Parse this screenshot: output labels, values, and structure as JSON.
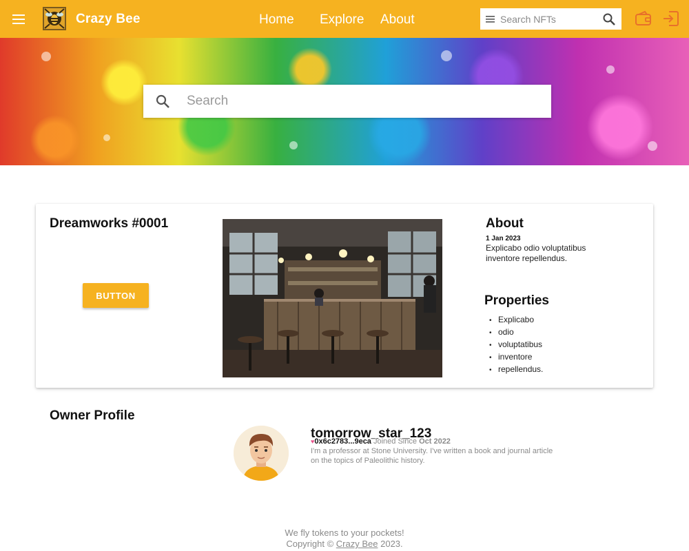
{
  "header": {
    "brand": "Crazy Bee",
    "nav": [
      "Home",
      "Explore",
      "About"
    ],
    "search_placeholder": "Search NFTs",
    "accent_color": "#f6b220",
    "icons": [
      "menu-icon",
      "bee-logo",
      "lines-icon",
      "search-icon",
      "wallet-icon",
      "login-icon"
    ]
  },
  "hero": {
    "search_placeholder": "Search"
  },
  "nft": {
    "title": "Dreamworks #0001",
    "button_label": "BUTTON",
    "about": {
      "heading": "About",
      "date": "1 Jan 2023",
      "description": "Explicabo odio voluptatibus inventore repellendus."
    },
    "properties": {
      "heading": "Properties",
      "items": [
        "Explicabo",
        "odio",
        "voluptatibus",
        "inventore",
        "repellendus."
      ]
    }
  },
  "owner": {
    "heading": "Owner Profile",
    "username": "tomorrow_star_123",
    "address": "0x6c2783...9eca",
    "joined_prefix": "Joined Since",
    "joined": "Oct 2022",
    "bio": "I'm a professor at Stone University. I've written a book and journal article on the topics of Paleolithic history."
  },
  "footer": {
    "tagline": "We fly tokens to your pockets!",
    "copyright_prefix": "Copyright ©",
    "copyright_link": "Crazy Bee",
    "copyright_year": "2023."
  }
}
